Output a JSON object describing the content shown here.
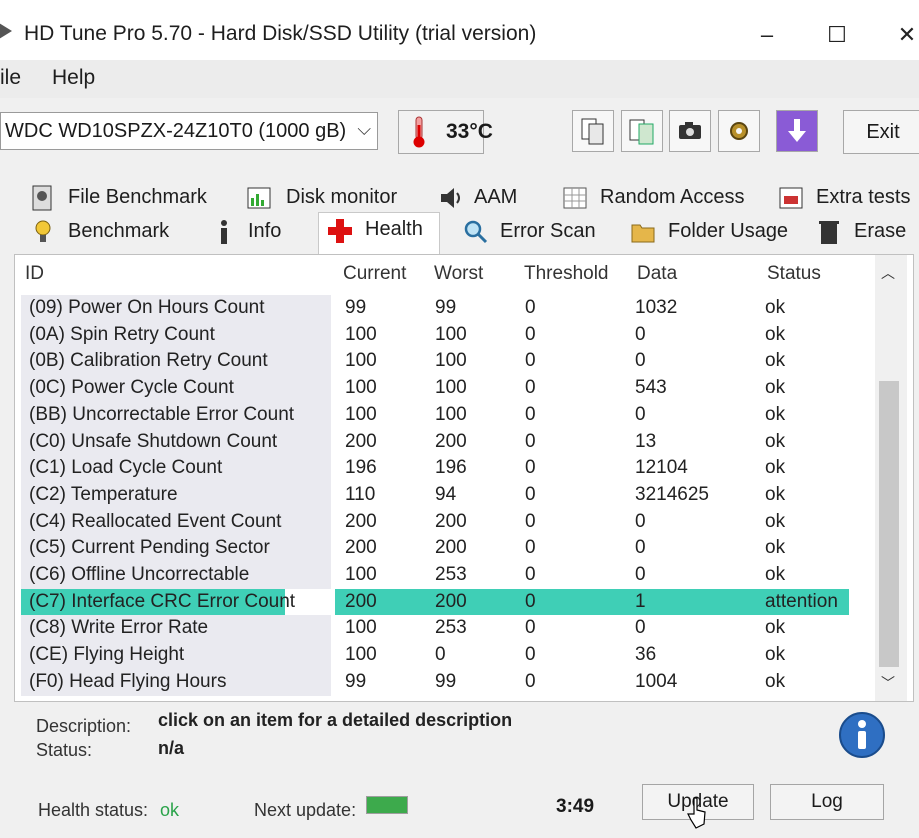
{
  "window": {
    "title": "HD Tune Pro 5.70 - Hard Disk/SSD Utility (trial version)",
    "minimize": "–",
    "maximize": "☐",
    "close": "✕"
  },
  "menu": {
    "file": "ile",
    "help": "Help"
  },
  "toolbar": {
    "drive": "WDC WD10SPZX-24Z10T0 (1000 gB)",
    "temperature": "33°C",
    "exit": "Exit"
  },
  "tabs": {
    "row1": [
      "File Benchmark",
      "Disk monitor",
      "AAM",
      "Random Access",
      "Extra tests"
    ],
    "row2": [
      "Benchmark",
      "Info",
      "Health",
      "Error Scan",
      "Folder Usage",
      "Erase"
    ]
  },
  "table": {
    "headers": [
      "ID",
      "Current",
      "Worst",
      "Threshold",
      "Data",
      "Status"
    ],
    "rows": [
      {
        "id": "(09) Power On Hours Count",
        "current": "99",
        "worst": "99",
        "threshold": "0",
        "data": "1032",
        "status": "ok"
      },
      {
        "id": "(0A) Spin Retry Count",
        "current": "100",
        "worst": "100",
        "threshold": "0",
        "data": "0",
        "status": "ok"
      },
      {
        "id": "(0B) Calibration Retry Count",
        "current": "100",
        "worst": "100",
        "threshold": "0",
        "data": "0",
        "status": "ok"
      },
      {
        "id": "(0C) Power Cycle Count",
        "current": "100",
        "worst": "100",
        "threshold": "0",
        "data": "543",
        "status": "ok"
      },
      {
        "id": "(BB) Uncorrectable Error Count",
        "current": "100",
        "worst": "100",
        "threshold": "0",
        "data": "0",
        "status": "ok"
      },
      {
        "id": "(C0) Unsafe Shutdown Count",
        "current": "200",
        "worst": "200",
        "threshold": "0",
        "data": "13",
        "status": "ok"
      },
      {
        "id": "(C1) Load Cycle Count",
        "current": "196",
        "worst": "196",
        "threshold": "0",
        "data": "12104",
        "status": "ok"
      },
      {
        "id": "(C2) Temperature",
        "current": "110",
        "worst": "94",
        "threshold": "0",
        "data": "3214625",
        "status": "ok"
      },
      {
        "id": "(C4) Reallocated Event Count",
        "current": "200",
        "worst": "200",
        "threshold": "0",
        "data": "0",
        "status": "ok"
      },
      {
        "id": "(C5) Current Pending Sector",
        "current": "200",
        "worst": "200",
        "threshold": "0",
        "data": "0",
        "status": "ok"
      },
      {
        "id": "(C6) Offline Uncorrectable",
        "current": "100",
        "worst": "253",
        "threshold": "0",
        "data": "0",
        "status": "ok"
      },
      {
        "id": "(C7) Interface CRC Error Count",
        "current": "200",
        "worst": "200",
        "threshold": "0",
        "data": "1",
        "status": "attention",
        "highlight": true
      },
      {
        "id": "(C8) Write Error Rate",
        "current": "100",
        "worst": "253",
        "threshold": "0",
        "data": "0",
        "status": "ok"
      },
      {
        "id": "(CE) Flying Height",
        "current": "100",
        "worst": "0",
        "threshold": "0",
        "data": "36",
        "status": "ok"
      },
      {
        "id": "(F0) Head Flying Hours",
        "current": "99",
        "worst": "99",
        "threshold": "0",
        "data": "1004",
        "status": "ok"
      }
    ]
  },
  "description": {
    "label": "Description:",
    "value": "click on an item for a detailed description",
    "status_label": "Status:",
    "status_value": "n/a"
  },
  "footer": {
    "health_label": "Health status:",
    "health_value": "ok",
    "next_update_label": "Next update:",
    "next_update_progress": 1.0,
    "countdown": "3:49",
    "update_button": "Update",
    "log_button": "Log"
  },
  "colors": {
    "highlight": "#3fcfb6",
    "health_ok": "#2aa34a",
    "accent_purple": "#8a5bd6"
  }
}
